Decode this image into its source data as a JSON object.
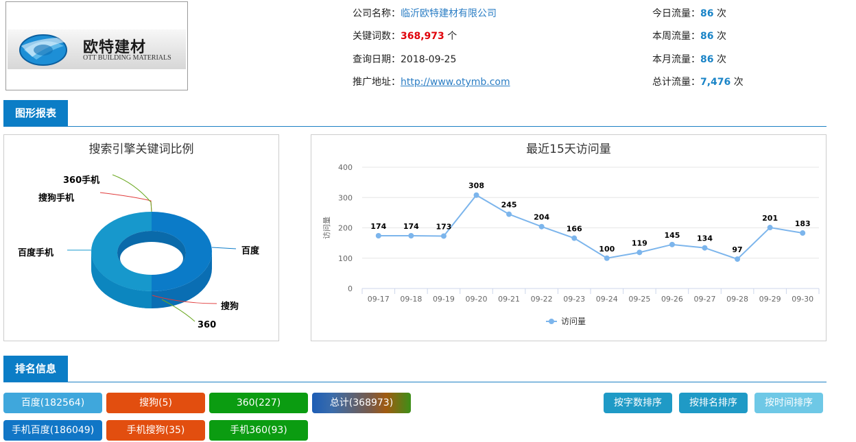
{
  "logo": {
    "name_cn": "欧特建材",
    "name_en": "OTT BUILDING MATERIALS"
  },
  "info": {
    "company_label": "公司名称：",
    "company_value": "临沂欧特建材有限公司",
    "keywords_label": "关键词数：",
    "keywords_value": "368,973",
    "keywords_unit": "个",
    "date_label": "查询日期：",
    "date_value": "2018-09-25",
    "url_label": "推广地址：",
    "url_value": "http://www.otymb.com",
    "today_label": "今日流量：",
    "today_value": "86",
    "today_unit": "次",
    "week_label": "本周流量：",
    "week_value": "86",
    "week_unit": "次",
    "month_label": "本月流量：",
    "month_value": "86",
    "month_unit": "次",
    "total_label": "总计流量：",
    "total_value": "7,476",
    "total_unit": "次"
  },
  "sections": {
    "report_tab": "图形报表",
    "ranking_tab": "排名信息"
  },
  "pie_chart": {
    "title": "搜索引擎关键词比例",
    "labels": {
      "s360m": "360手机",
      "sogoum": "搜狗手机",
      "baidum": "百度手机",
      "baidu": "百度",
      "sogou": "搜狗",
      "s360": "360"
    }
  },
  "chart_data": {
    "type": "line",
    "title": "最近15天访问量",
    "ylabel": "访问量",
    "categories": [
      "09-17",
      "09-18",
      "09-19",
      "09-20",
      "09-21",
      "09-22",
      "09-23",
      "09-24",
      "09-25",
      "09-26",
      "09-27",
      "09-28",
      "09-29",
      "09-30"
    ],
    "series": [
      {
        "name": "访问量",
        "values": [
          174,
          174,
          173,
          308,
          245,
          204,
          166,
          100,
          119,
          145,
          134,
          97,
          201,
          183
        ]
      }
    ],
    "ylim": [
      0,
      400
    ],
    "yticks": [
      0,
      100,
      200,
      300,
      400
    ],
    "grid": true,
    "legend": "bottom",
    "color": "#7cb5ec"
  },
  "buttons": {
    "baidu": "百度(182564)",
    "sogou": "搜狗(5)",
    "s360": "360(227)",
    "total": "总计(368973)",
    "sort_chars": "按字数排序",
    "sort_rank": "按排名排序",
    "sort_time": "按时间排序",
    "m_baidu": "手机百度(186049)",
    "m_sogou": "手机搜狗(35)",
    "m_360": "手机360(93)"
  }
}
